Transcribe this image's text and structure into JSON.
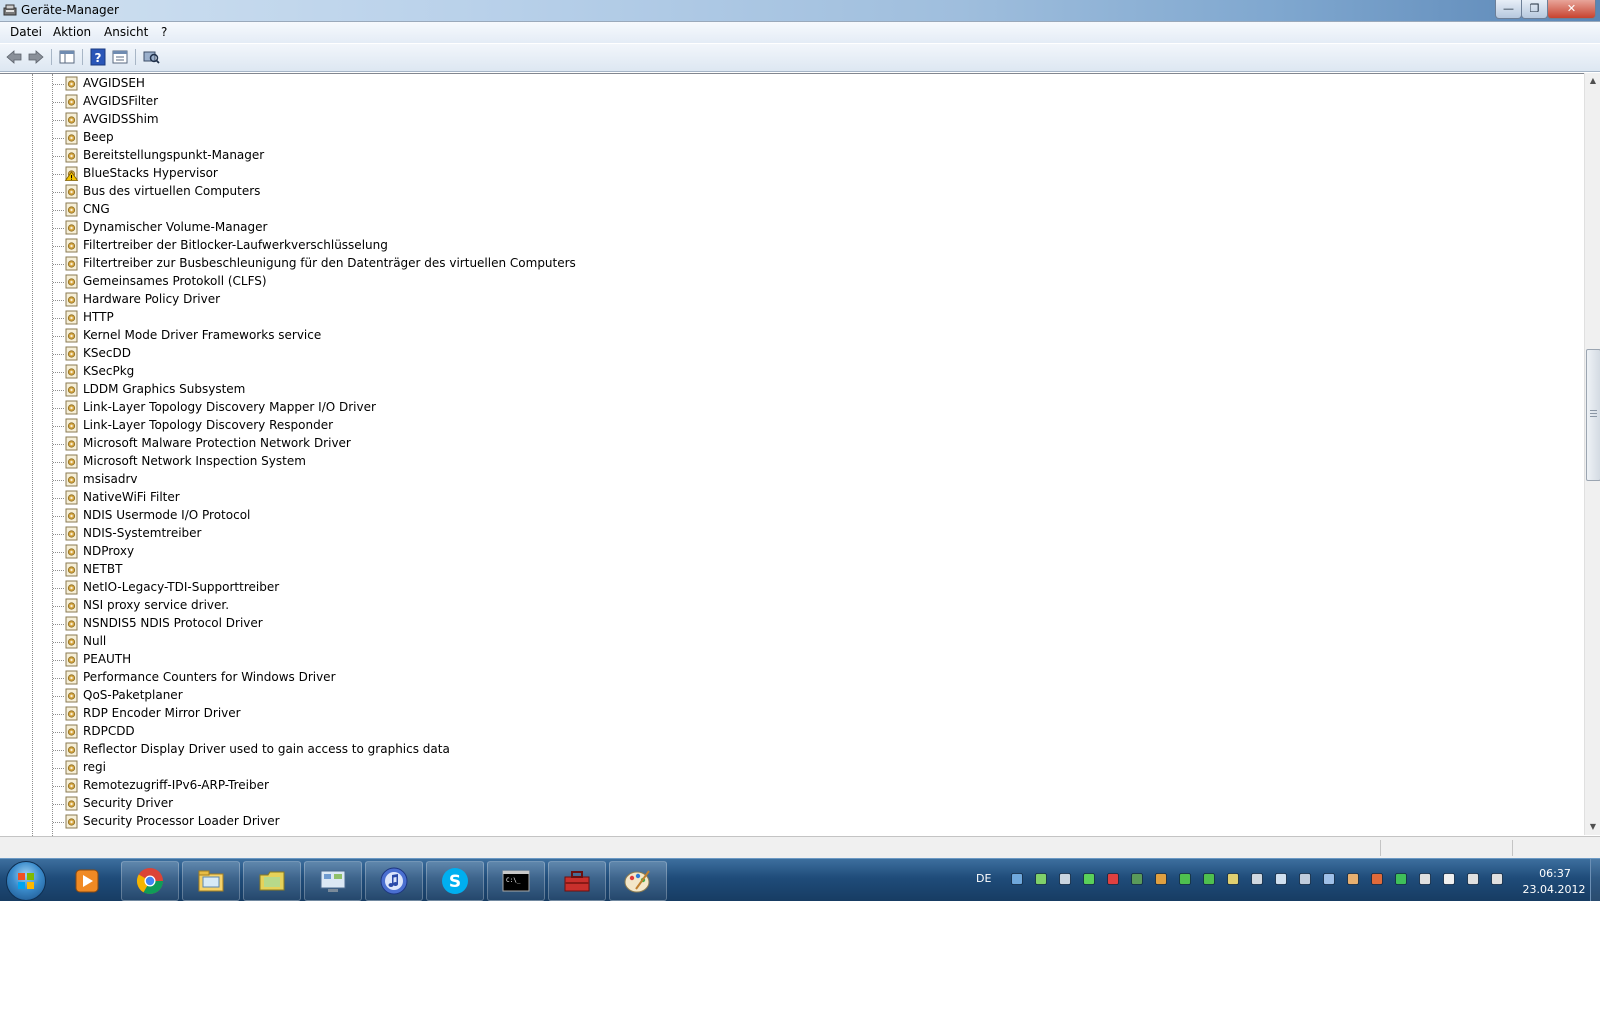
{
  "window": {
    "title": "Geräte-Manager",
    "controls": {
      "minimize": "—",
      "maximize": "❐",
      "close": "✕"
    }
  },
  "menu": [
    {
      "label": "Datei"
    },
    {
      "label": "Aktion"
    },
    {
      "label": "Ansicht"
    },
    {
      "label": "?"
    }
  ],
  "toolbar": {
    "buttons": [
      "back-icon",
      "forward-icon",
      "show-hide-console-tree-icon",
      "help-icon",
      "properties-icon",
      "scan-hardware-icon"
    ]
  },
  "tree": {
    "items": [
      {
        "label": "AVGIDSEH",
        "icon": "driver-icon"
      },
      {
        "label": "AVGIDSFilter",
        "icon": "driver-icon"
      },
      {
        "label": "AVGIDSShim",
        "icon": "driver-icon"
      },
      {
        "label": "Beep",
        "icon": "driver-icon"
      },
      {
        "label": "Bereitstellungspunkt-Manager",
        "icon": "driver-icon"
      },
      {
        "label": "BlueStacks Hypervisor",
        "icon": "warning-driver-icon"
      },
      {
        "label": "Bus des virtuellen Computers",
        "icon": "driver-icon"
      },
      {
        "label": "CNG",
        "icon": "driver-icon"
      },
      {
        "label": "Dynamischer Volume-Manager",
        "icon": "driver-icon"
      },
      {
        "label": "Filtertreiber der Bitlocker-Laufwerkverschlüsselung",
        "icon": "driver-icon"
      },
      {
        "label": "Filtertreiber zur Busbeschleunigung für den Datenträger des virtuellen Computers",
        "icon": "driver-icon"
      },
      {
        "label": "Gemeinsames Protokoll (CLFS)",
        "icon": "driver-icon"
      },
      {
        "label": "Hardware Policy Driver",
        "icon": "driver-icon"
      },
      {
        "label": "HTTP",
        "icon": "driver-icon"
      },
      {
        "label": "Kernel Mode Driver Frameworks service",
        "icon": "driver-icon"
      },
      {
        "label": "KSecDD",
        "icon": "driver-icon"
      },
      {
        "label": "KSecPkg",
        "icon": "driver-icon"
      },
      {
        "label": "LDDM Graphics Subsystem",
        "icon": "driver-icon"
      },
      {
        "label": "Link-Layer Topology Discovery Mapper I/O Driver",
        "icon": "driver-icon"
      },
      {
        "label": "Link-Layer Topology Discovery Responder",
        "icon": "driver-icon"
      },
      {
        "label": "Microsoft Malware Protection Network Driver",
        "icon": "driver-icon"
      },
      {
        "label": "Microsoft Network Inspection System",
        "icon": "driver-icon"
      },
      {
        "label": "msisadrv",
        "icon": "driver-icon"
      },
      {
        "label": "NativeWiFi Filter",
        "icon": "driver-icon"
      },
      {
        "label": "NDIS Usermode I/O Protocol",
        "icon": "driver-icon"
      },
      {
        "label": "NDIS-Systemtreiber",
        "icon": "driver-icon"
      },
      {
        "label": "NDProxy",
        "icon": "driver-icon"
      },
      {
        "label": "NETBT",
        "icon": "driver-icon"
      },
      {
        "label": "NetIO-Legacy-TDI-Supporttreiber",
        "icon": "driver-icon"
      },
      {
        "label": "NSI proxy service driver.",
        "icon": "driver-icon"
      },
      {
        "label": "NSNDIS5 NDIS Protocol Driver",
        "icon": "driver-icon"
      },
      {
        "label": "Null",
        "icon": "driver-icon"
      },
      {
        "label": "PEAUTH",
        "icon": "driver-icon"
      },
      {
        "label": "Performance Counters for Windows Driver",
        "icon": "driver-icon"
      },
      {
        "label": "QoS-Paketplaner",
        "icon": "driver-icon"
      },
      {
        "label": "RDP Encoder Mirror Driver",
        "icon": "driver-icon"
      },
      {
        "label": "RDPCDD",
        "icon": "driver-icon"
      },
      {
        "label": "Reflector Display Driver used to gain access to graphics data",
        "icon": "driver-icon"
      },
      {
        "label": "regi",
        "icon": "driver-icon"
      },
      {
        "label": "Remotezugriff-IPv6-ARP-Treiber",
        "icon": "driver-icon"
      },
      {
        "label": "Security Driver",
        "icon": "driver-icon"
      },
      {
        "label": "Security Processor Loader Driver",
        "icon": "driver-icon"
      }
    ]
  },
  "taskbar": {
    "apps": [
      "media-player-icon",
      "chrome-icon",
      "explorer-icon",
      "folder-icon",
      "control-panel-icon",
      "itunes-icon",
      "skype-icon",
      "cmd-icon",
      "toolbox-icon",
      "paint-icon"
    ],
    "language": "DE",
    "tray_icons": [
      "help-icon",
      "network-icon",
      "monitor-icon",
      "chat-icon",
      "antivirus-icon",
      "shield-icon",
      "flag-icon",
      "arrow-up-icon",
      "arrow-up-icon",
      "sync-icon",
      "display-icon",
      "bluetooth-icon",
      "device-icon",
      "transfer-icon",
      "pen-icon",
      "refresh-icon",
      "check-icon",
      "volume-icon",
      "action-center-icon",
      "signal-icon",
      "power-icon"
    ],
    "clock": {
      "time": "06:37",
      "date": "23.04.2012"
    }
  },
  "colors": {
    "taskbar": "#1f4c7a",
    "titlebar": "#b9d1ea",
    "driver_icon": "#c9a24a",
    "warning": "#f2c200"
  }
}
